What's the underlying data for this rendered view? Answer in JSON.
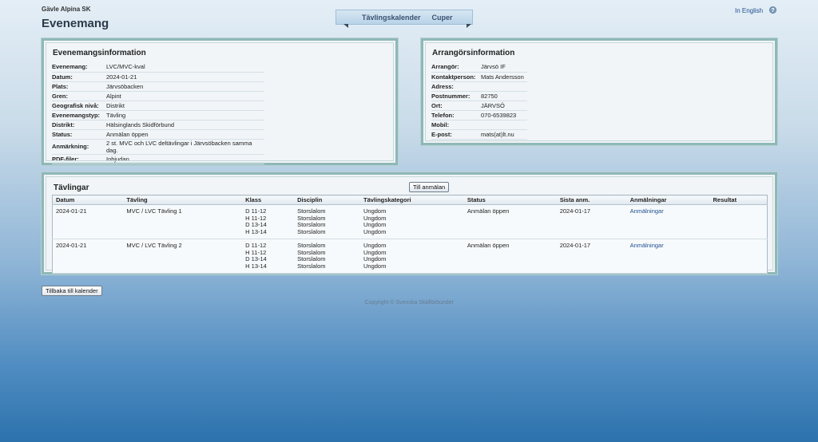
{
  "header": {
    "club": "Gävle Alpina SK",
    "title": "Evenemang",
    "language_link": "In English",
    "help_icon": "help-icon"
  },
  "nav": {
    "tabs": [
      {
        "label": "Tävlingskalender"
      },
      {
        "label": "Cuper"
      }
    ]
  },
  "event_info": {
    "heading": "Evenemangsinformation",
    "rows": [
      {
        "key": "Evenemang:",
        "value": "LVC/MVC-kval"
      },
      {
        "key": "Datum:",
        "value": "2024-01-21"
      },
      {
        "key": "Plats:",
        "value": "Järvsöbacken"
      },
      {
        "key": "Gren:",
        "value": "Alpint"
      },
      {
        "key": "Geografisk nivå:",
        "value": "Distrikt"
      },
      {
        "key": "Evenemangstyp:",
        "value": "Tävling"
      },
      {
        "key": "Distrikt:",
        "value": "Hälsinglands Skidförbund"
      },
      {
        "key": "Status:",
        "value": "Anmälan öppen"
      },
      {
        "key": "Anmärkning:",
        "value": "2 st. MVC och LVC deltävlingar i Järvsöbacken samma dag."
      },
      {
        "key": "PDF-filer:",
        "value": "Inbjudan"
      }
    ]
  },
  "organizer_info": {
    "heading": "Arrangörsinformation",
    "rows": [
      {
        "key": "Arrangör:",
        "value": "Järvsö IF"
      },
      {
        "key": "Kontaktperson:",
        "value": "Mats Andersson"
      },
      {
        "key": "Adress:",
        "value": ""
      },
      {
        "key": "Postnummer:",
        "value": "82750"
      },
      {
        "key": "Ort:",
        "value": "JÄRVSÖ"
      },
      {
        "key": "Telefon:",
        "value": "070-6539823"
      },
      {
        "key": "Mobil:",
        "value": ""
      },
      {
        "key": "E-post:",
        "value": "mats(at)lt.nu"
      }
    ]
  },
  "competitions": {
    "heading": "Tävlingar",
    "register_button": "Till anmälan",
    "columns": [
      "Datum",
      "Tävling",
      "Klass",
      "Disciplin",
      "Tävlingskategori",
      "Status",
      "Sista anm.",
      "Anmälningar",
      "Resultat"
    ],
    "rows": [
      {
        "date": "2024-01-21",
        "name": "MVC / LVC Tävling 1",
        "classes": [
          "D 11-12",
          "H 11-12",
          "D 13-14",
          "H 13-14"
        ],
        "disciplines": [
          "Storslalom",
          "Storslalom",
          "Storslalom",
          "Storslalom"
        ],
        "categories": [
          "Ungdom",
          "Ungdom",
          "Ungdom",
          "Ungdom"
        ],
        "status": "Anmälan öppen",
        "deadline": "2024-01-17",
        "registrations": "Anmälningar",
        "results": ""
      },
      {
        "date": "2024-01-21",
        "name": "MVC / LVC Tävling 2",
        "classes": [
          "D 11-12",
          "H 11-12",
          "D 13-14",
          "H 13-14"
        ],
        "disciplines": [
          "Storslalom",
          "Storslalom",
          "Storslalom",
          "Storslalom"
        ],
        "categories": [
          "Ungdom",
          "Ungdom",
          "Ungdom",
          "Ungdom"
        ],
        "status": "Anmälan öppen",
        "deadline": "2024-01-17",
        "registrations": "Anmälningar",
        "results": ""
      }
    ]
  },
  "back_button": "Tillbaka till kalender",
  "footer": "Copyright © Svenska Skidförbundet"
}
